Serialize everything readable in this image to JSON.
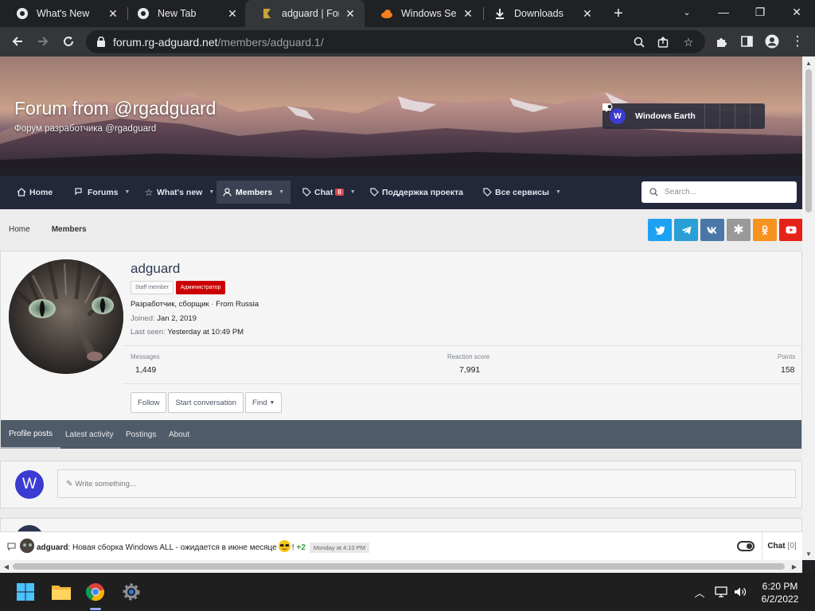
{
  "browser": {
    "tabs": [
      {
        "title": "What's New",
        "icon": "github-icon"
      },
      {
        "title": "New Tab",
        "icon": "chrome-icon"
      },
      {
        "title": "adguard | Forum",
        "icon": "forum-favicon-icon"
      },
      {
        "title": "Windows Server",
        "icon": "cloud-icon"
      },
      {
        "title": "Downloads",
        "icon": "download-icon"
      }
    ],
    "active_tab_index": 2,
    "url_host": "forum.rg-adguard.net",
    "url_path": "/members/adguard.1/"
  },
  "site": {
    "title": "Forum from @rgadguard",
    "subtitle": "Форум разработчика @rgadguard",
    "user": {
      "initial": "W",
      "name": "Windows Earth"
    }
  },
  "nav": {
    "items": [
      {
        "label": "Home",
        "icon": "home-icon"
      },
      {
        "label": "Forums",
        "icon": "comments-icon"
      },
      {
        "label": "What's new",
        "icon": "star-icon"
      },
      {
        "label": "Members",
        "icon": "user-icon"
      },
      {
        "label": "Chat",
        "icon": "tag-icon",
        "badge": "0"
      },
      {
        "label": "Поддержка проекта",
        "icon": "tag-icon"
      },
      {
        "label": "Все сервисы",
        "icon": "tag-icon"
      }
    ],
    "search_placeholder": "Search..."
  },
  "breadcrumb": [
    "Home",
    "Members"
  ],
  "socials": [
    {
      "name": "twitter",
      "color": "#1da1f2"
    },
    {
      "name": "telegram",
      "color": "#2a9fd6"
    },
    {
      "name": "vk",
      "color": "#4a76a8"
    },
    {
      "name": "asterisk",
      "color": "#999999"
    },
    {
      "name": "odnoklassniki",
      "color": "#f7931e"
    },
    {
      "name": "youtube",
      "color": "#e62117"
    }
  ],
  "profile": {
    "username": "adguard",
    "badge_staff": "Staff member",
    "badge_admin": "Администратор",
    "title_line": "Разработчик, сборщик",
    "location": "From Russia",
    "joined_label": "Joined:",
    "joined": "Jan 2, 2019",
    "last_seen_label": "Last seen:",
    "last_seen": "Yesterday at 10:49 PM",
    "stats": [
      {
        "label": "Messages",
        "value": "1,449"
      },
      {
        "label": "Reaction score",
        "value": "7,991"
      },
      {
        "label": "Points",
        "value": "158"
      }
    ],
    "buttons": {
      "follow": "Follow",
      "start_conversation": "Start conversation",
      "find": "Find"
    },
    "tabs": [
      "Profile posts",
      "Latest activity",
      "Postings",
      "About"
    ]
  },
  "post": {
    "avatar_initial": "W",
    "placeholder": "Write something..."
  },
  "chat": {
    "author": "adguard",
    "message": "Новая сборка Windows ALL - ожидается в июне месяце",
    "reactions": "+2",
    "time": "Monday at 4:10 PM",
    "button_label": "Chat",
    "count": "[0]"
  },
  "taskbar": {
    "time": "6:20 PM",
    "date": "6/2/2022"
  },
  "colors": {
    "nav_bg": "#22273a",
    "tabs_bg": "#4f5b68",
    "admin_badge": "#cc0000",
    "avatar_blue": "#3b3bd1"
  }
}
